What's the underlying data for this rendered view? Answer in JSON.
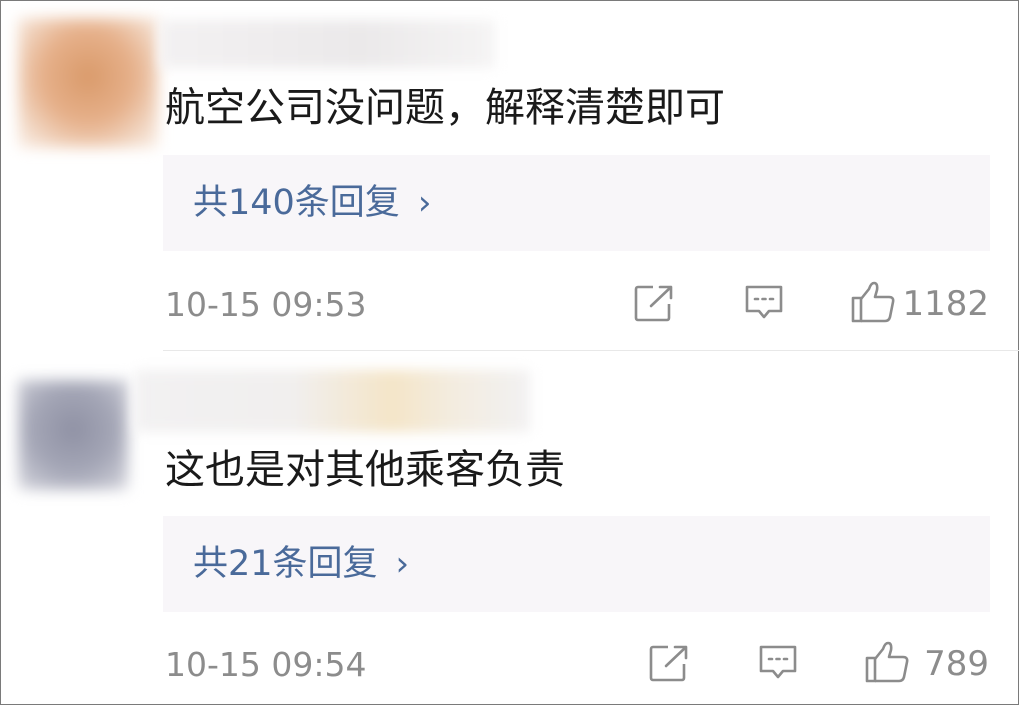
{
  "comments": [
    {
      "text": "航空公司没问题，解释清楚即可",
      "replies_label": "共140条回复",
      "timestamp": "10-15 09:53",
      "likes": "1182",
      "avatar_color": "#e0a47a",
      "name_bar_color": "#ece8ea"
    },
    {
      "text": "这也是对其他乘客负责",
      "replies_label": "共21条回复",
      "timestamp": "10-15 09:54",
      "likes": "789",
      "avatar_color": "#9d9fb0",
      "name_bar_color": "#f1e6d0"
    }
  ],
  "icons": {
    "chevron": "chevron-right-icon",
    "share": "share-icon",
    "comment": "comment-icon",
    "like": "thumbs-up-icon"
  },
  "colors": {
    "link": "#4a6a9a",
    "meta": "#8c8c8c",
    "reply_bg": "#f8f6f9"
  }
}
